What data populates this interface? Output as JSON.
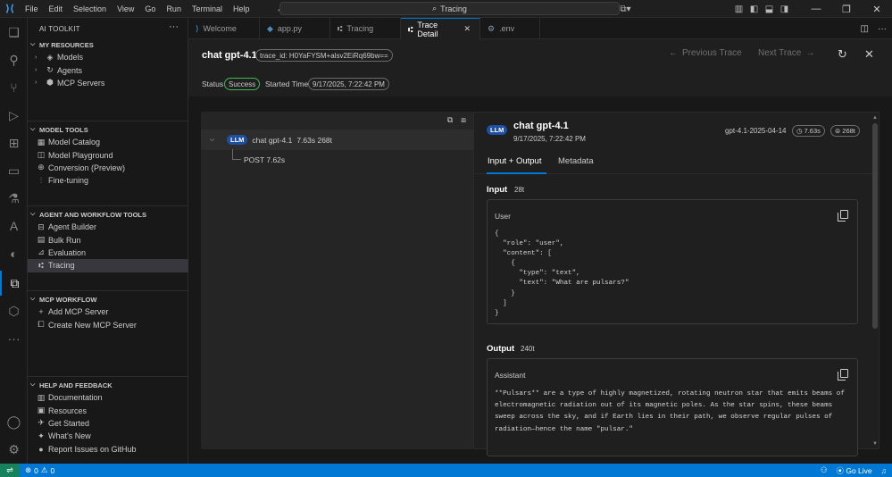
{
  "titlebar": {
    "menu": [
      "File",
      "Edit",
      "Selection",
      "View",
      "Go",
      "Run",
      "Terminal",
      "Help"
    ],
    "search": "Tracing"
  },
  "sidebar": {
    "title": "AI TOOLKIT",
    "sections": [
      {
        "title": "MY RESOURCES",
        "items": [
          {
            "label": "Models",
            "icon": "cube-icon"
          },
          {
            "label": "Agents",
            "icon": "agent-icon"
          },
          {
            "label": "MCP Servers",
            "icon": "mcp-icon"
          }
        ]
      },
      {
        "title": "MODEL TOOLS",
        "items": [
          {
            "label": "Model Catalog",
            "icon": "catalog-icon"
          },
          {
            "label": "Model Playground",
            "icon": "playground-icon"
          },
          {
            "label": "Conversion (Preview)",
            "icon": "conversion-icon"
          },
          {
            "label": "Fine-tuning",
            "icon": "tuning-icon"
          }
        ]
      },
      {
        "title": "AGENT AND WORKFLOW TOOLS",
        "items": [
          {
            "label": "Agent Builder",
            "icon": "builder-icon"
          },
          {
            "label": "Bulk Run",
            "icon": "bulk-run-icon"
          },
          {
            "label": "Evaluation",
            "icon": "evaluation-icon"
          },
          {
            "label": "Tracing",
            "icon": "tracing-icon"
          }
        ]
      },
      {
        "title": "MCP WORKFLOW",
        "items": [
          {
            "label": "Add MCP Server",
            "icon": "plus-icon"
          },
          {
            "label": "Create New MCP Server",
            "icon": "new-server-icon"
          }
        ]
      },
      {
        "title": "HELP AND FEEDBACK",
        "items": [
          {
            "label": "Documentation",
            "icon": "documentation-icon"
          },
          {
            "label": "Resources",
            "icon": "resources-icon"
          },
          {
            "label": "Get Started",
            "icon": "rocket-icon"
          },
          {
            "label": "What's New",
            "icon": "whats-new-icon"
          },
          {
            "label": "Report Issues on GitHub",
            "icon": "github-icon"
          }
        ]
      }
    ]
  },
  "tabs": [
    {
      "label": "Welcome",
      "icon": "vscode-icon"
    },
    {
      "label": "app.py",
      "icon": "python-icon"
    },
    {
      "label": "Tracing",
      "icon": "tracing-icon"
    },
    {
      "label": "Trace Detail",
      "icon": "trace-detail-icon"
    },
    {
      "label": ".env",
      "icon": "gear-icon"
    }
  ],
  "trace": {
    "title": "chat gpt-4.1",
    "trace_id": "trace_id: H0YaFYSM+alsv2EiRq69bw==",
    "prev_label": "Previous Trace",
    "next_label": "Next Trace",
    "status_label": "Status",
    "status_value": "Success",
    "started_label": "Started Time",
    "started_value": "9/17/2025, 7:22:42 PM"
  },
  "tree": {
    "badge": "LLM",
    "root_label": "chat gpt-4.1",
    "root_meta": "7.63s 268t",
    "child_label": "POST 7.62s"
  },
  "detail": {
    "badge": "LLM",
    "title": "chat gpt-4.1",
    "date": "9/17/2025, 7:22:42 PM",
    "model": "gpt-4.1-2025-04-14",
    "duration": "7.63s",
    "tokens": "268t",
    "tab_input_output": "Input + Output",
    "tab_metadata": "Metadata",
    "input_title": "Input",
    "input_tokens": "28t",
    "input_role": "User",
    "input_code": "{\n  \"role\": \"user\",\n  \"content\": [\n    {\n      \"type\": \"text\",\n      \"text\": \"What are pulsars?\"\n    }\n  ]\n}",
    "output_title": "Output",
    "output_tokens": "240t",
    "output_role": "Assistant",
    "output_text": "**Pulsars** are a type of highly magnetized, rotating neutron star that emits beams of electromagnetic radiation out of its magnetic poles. As the star spins, these beams sweep across the sky, and if Earth lies in their path, we observe regular pulses of radiation—hence the name \"pulsar.\""
  },
  "statusbar": {
    "errors": "0",
    "warnings": "0",
    "golive": "Go Live"
  }
}
